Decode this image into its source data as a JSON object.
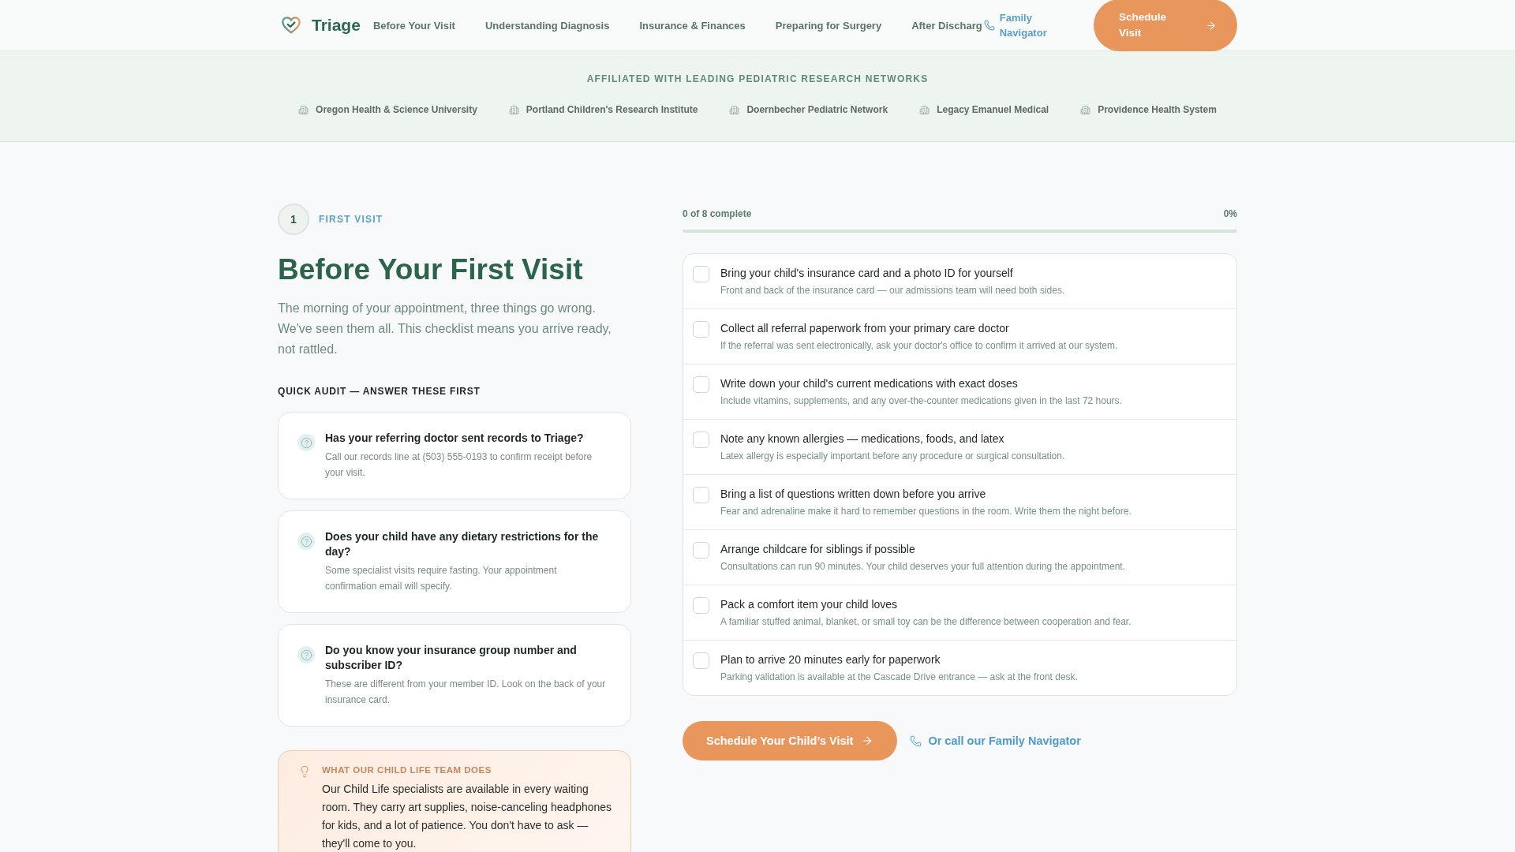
{
  "header": {
    "brand": "Triage",
    "nav": [
      "Before Your Visit",
      "Understanding Diagnosis",
      "Insurance & Finances",
      "Preparing for Surgery",
      "After Discharg"
    ],
    "navigator_link": "Family Navigator",
    "cta": "Schedule Visit"
  },
  "affiliations": {
    "title": "AFFILIATED WITH LEADING PEDIATRIC RESEARCH NETWORKS",
    "items": [
      "Oregon Health & Science University",
      "Portland Children's Research Institute",
      "Doernbecher Pediatric Network",
      "Legacy Emanuel Medical",
      "Providence Health System"
    ]
  },
  "intro": {
    "step_number": "1",
    "step_label": "FIRST VISIT",
    "title": "Before Your First Visit",
    "lead": "The morning of your appointment, three things go wrong. We've seen them all. This checklist means you arrive ready, not rattled."
  },
  "audit": {
    "title": "QUICK AUDIT — ANSWER THESE FIRST",
    "questions": [
      {
        "question": "Has your referring doctor sent records to Triage?",
        "hint": "Call our records line at (503) 555-0193 to confirm receipt before your visit."
      },
      {
        "question": "Does your child have any dietary restrictions for the day?",
        "hint": "Some specialist visits require fasting. Your appointment confirmation email will specify."
      },
      {
        "question": "Do you know your insurance group number and subscriber ID?",
        "hint": "These are different from your member ID. Look on the back of your insurance card."
      }
    ]
  },
  "tip": {
    "label": "WHAT OUR CHILD LIFE TEAM DOES",
    "text": "Our Child Life specialists are available in every waiting room. They carry art supplies, noise-canceling headphones for kids, and a lot of patience. You don't have to ask — they'll come to you."
  },
  "progress": {
    "summary": "0 of 8 complete",
    "percent": "0%",
    "level": 0
  },
  "checklist": [
    {
      "title": "Bring your child's insurance card and a photo ID for yourself",
      "note": "Front and back of the insurance card — our admissions team will need both sides.",
      "checked": false
    },
    {
      "title": "Collect all referral paperwork from your primary care doctor",
      "note": "If the referral was sent electronically, ask your doctor's office to confirm it arrived at our system.",
      "checked": false
    },
    {
      "title": "Write down your child's current medications with exact doses",
      "note": "Include vitamins, supplements, and any over-the-counter medications given in the last 72 hours.",
      "checked": false
    },
    {
      "title": "Note any known allergies — medications, foods, and latex",
      "note": "Latex allergy is especially important before any procedure or surgical consultation.",
      "checked": false
    },
    {
      "title": "Bring a list of questions written down before you arrive",
      "note": "Fear and adrenaline make it hard to remember questions in the room. Write them the night before.",
      "checked": false
    },
    {
      "title": "Arrange childcare for siblings if possible",
      "note": "Consultations can run 90 minutes. Your child deserves your full attention during the appointment.",
      "checked": false
    },
    {
      "title": "Pack a comfort item your child loves",
      "note": "A familiar stuffed animal, blanket, or small toy can be the difference between cooperation and fear.",
      "checked": false
    },
    {
      "title": "Plan to arrive 20 minutes early for paperwork",
      "note": "Parking validation is available at the Cascade Drive entrance — ask at the front desk.",
      "checked": false
    }
  ],
  "actions": {
    "schedule": "Schedule Your Child’s Visit",
    "call": "Or call our Family Navigator"
  }
}
